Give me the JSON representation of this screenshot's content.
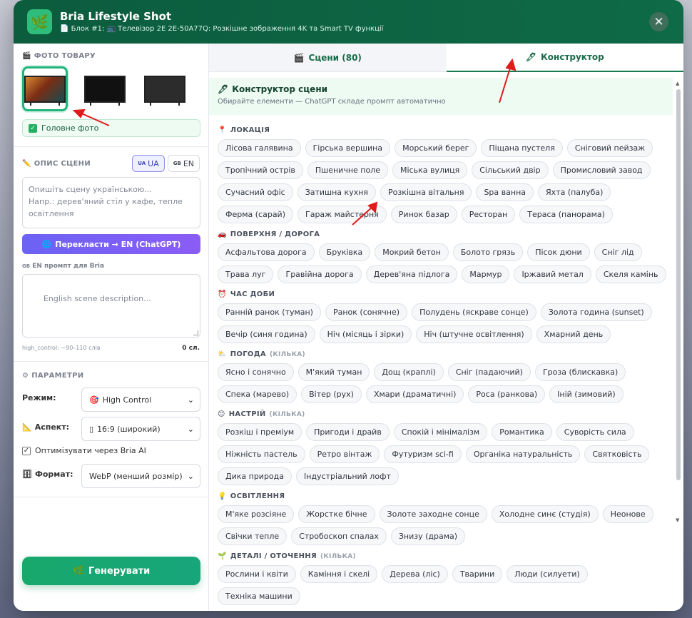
{
  "header": {
    "title": "Bria Lifestyle Shot",
    "subtitle": "📄 Блок #1: 📺 Телевізор 2E 2E-50A77Q: Розкішне зображення 4K та Smart TV функції",
    "logo_icon": "🌿",
    "close": "✕"
  },
  "left": {
    "photos_title": "ФОТО ТОВАРУ",
    "main_photo_label": "Головне фото",
    "desc_title": "ОПИС СЦЕНИ",
    "lang_ua": "UA",
    "lang_ua_code": "UA",
    "lang_en": "EN",
    "lang_en_code": "GB",
    "desc_placeholder": "Опишіть сцену українською...\nНапр.: дерев'яний стіл у кафе, тепле освітлення",
    "translate_label": "Перекласти → EN (ChatGPT)",
    "en_prompt_label": "EN промпт для Bria",
    "en_prompt_code": "GB",
    "en_placeholder": "English scene description...",
    "hint": "high_control: ~90–110 слів",
    "word_count": "0 сл.",
    "params_title": "ПАРАМЕТРИ",
    "mode_label": "Режим:",
    "mode_value": "High Control",
    "aspect_label": "Аспект:",
    "aspect_value": "16:9 (широкий)",
    "optimize_label": "Оптимізувати через Bria AI",
    "optimize_checked": true,
    "format_label": "Формат:",
    "format_value": "WebP (менший розмір)",
    "generate_label": "Генерувати"
  },
  "tabs": [
    {
      "label": "Сцени (80)",
      "icon": "🎬"
    },
    {
      "label": "Конструктор",
      "icon": "🖊"
    }
  ],
  "builder": {
    "title": "Конструктор сцени",
    "subtitle": "Обирайте елементи — ChatGPT складе промпт автоматично"
  },
  "groups": [
    {
      "icon": "📍",
      "title": "ЛОКАЦІЯ",
      "multi": "",
      "chips": [
        "Лісова галявина",
        "Гірська вершина",
        "Морський берег",
        "Піщана пустеля",
        "Сніговий пейзаж",
        "Тропічний острів",
        "Пшеничне поле",
        "Міська вулиця",
        "Сільський двір",
        "Промисловий завод",
        "Сучасний офіс",
        "Затишна кухня",
        "Розкішна вітальня",
        "Spa ванна",
        "Яхта (палуба)",
        "Ферма (сарай)",
        "Гараж майстерня",
        "Ринок базар",
        "Ресторан",
        "Тераса (панорама)"
      ]
    },
    {
      "icon": "🚗",
      "title": "ПОВЕРХНЯ / ДОРОГА",
      "multi": "",
      "chips": [
        "Асфальтова дорога",
        "Бруківка",
        "Мокрий бетон",
        "Болото грязь",
        "Пісок дюни",
        "Сніг лід",
        "Трава луг",
        "Гравійна дорога",
        "Дерев'яна підлога",
        "Мармур",
        "Іржавий метал",
        "Скеля камінь"
      ]
    },
    {
      "icon": "⏰",
      "title": "ЧАС ДОБИ",
      "multi": "",
      "chips": [
        "Ранній ранок (туман)",
        "Ранок (сонячне)",
        "Полудень (яскраве сонце)",
        "Золота година (sunset)",
        "Вечір (синя година)",
        "Ніч (місяць і зірки)",
        "Ніч (штучне освітлення)",
        "Хмарний день"
      ]
    },
    {
      "icon": "⛅",
      "title": "ПОГОДА",
      "multi": "(КІЛЬКА)",
      "chips": [
        "Ясно і сонячно",
        "М'який туман",
        "Дощ (краплі)",
        "Сніг (падаючий)",
        "Гроза (блискавка)",
        "Спека (марево)",
        "Вітер (рух)",
        "Хмари (драматичні)",
        "Роса (ранкова)",
        "Іній (зимовий)"
      ]
    },
    {
      "icon": "😊",
      "title": "НАСТРІЙ",
      "multi": "(КІЛЬКА)",
      "chips": [
        "Розкіш і преміум",
        "Пригоди і драйв",
        "Спокій і мінімалізм",
        "Романтика",
        "Суворість сила",
        "Ніжність пастель",
        "Ретро вінтаж",
        "Футуризм sci-fi",
        "Органіка натуральність",
        "Святковість",
        "Дика природа",
        "Індустріальний лофт"
      ]
    },
    {
      "icon": "💡",
      "title": "ОСВІТЛЕННЯ",
      "multi": "",
      "chips": [
        "М'яке розсіяне",
        "Жорстке бічне",
        "Золоте заходне сонце",
        "Холодне синє (студія)",
        "Неонове",
        "Свічки тепле",
        "Стробоскоп спалах",
        "Знизу (драма)"
      ]
    },
    {
      "icon": "🌱",
      "title": "ДЕТАЛІ / ОТОЧЕННЯ",
      "multi": "(КІЛЬКА)",
      "chips": [
        "Рослини і квіти",
        "Каміння і скелі",
        "Дерева (ліс)",
        "Тварини",
        "Люди (силуети)",
        "Техніка машини"
      ]
    }
  ],
  "colors": {
    "brand": "#0e6a47",
    "accent": "#18a86c",
    "translate": "#7c5cf5",
    "annotation_arrow": "#e01b1b"
  }
}
